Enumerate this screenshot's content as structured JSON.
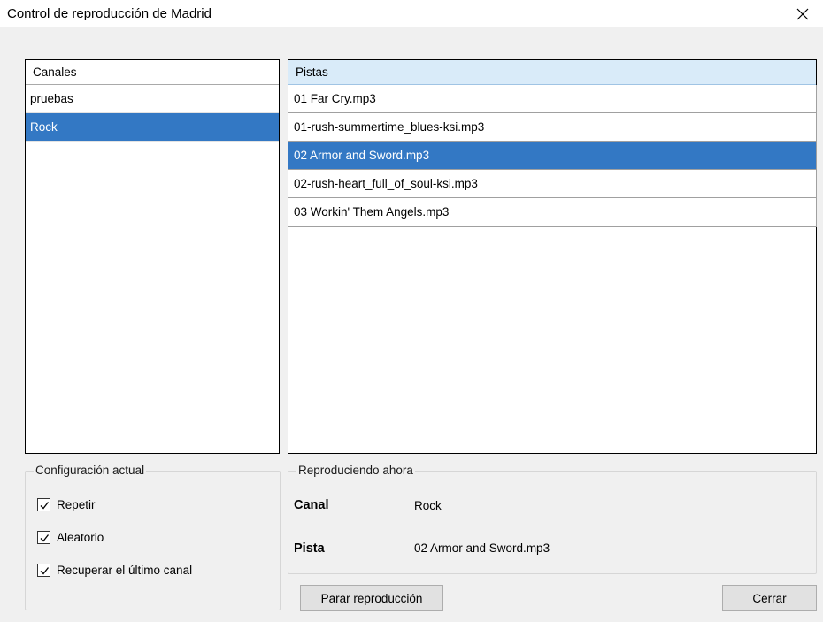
{
  "window": {
    "title": "Control de reproducción de Madrid",
    "close_icon": "close-icon"
  },
  "channels": {
    "header": "Canales",
    "items": [
      {
        "label": "pruebas",
        "selected": false
      },
      {
        "label": "Rock",
        "selected": true
      }
    ]
  },
  "tracks": {
    "header": "Pistas",
    "items": [
      {
        "label": "01 Far Cry.mp3",
        "selected": false
      },
      {
        "label": "01-rush-summertime_blues-ksi.mp3",
        "selected": false
      },
      {
        "label": "02 Armor and Sword.mp3",
        "selected": true
      },
      {
        "label": "02-rush-heart_full_of_soul-ksi.mp3",
        "selected": false
      },
      {
        "label": "03 Workin' Them Angels.mp3",
        "selected": false
      }
    ]
  },
  "config": {
    "legend": "Configuración actual",
    "repeat": {
      "label": "Repetir",
      "checked": true
    },
    "shuffle": {
      "label": "Aleatorio",
      "checked": true
    },
    "restore_last": {
      "label": "Recuperar el último canal",
      "checked": true
    }
  },
  "now_playing": {
    "legend": "Reproduciendo ahora",
    "channel_label": "Canal",
    "channel_value": "Rock",
    "track_label": "Pista",
    "track_value": "02 Armor and Sword.mp3"
  },
  "buttons": {
    "stop": "Parar reproducción",
    "close": "Cerrar"
  },
  "colors": {
    "selection": "#3378c4",
    "tracks_header": "#d9ebf9",
    "background": "#f0f0f0"
  }
}
